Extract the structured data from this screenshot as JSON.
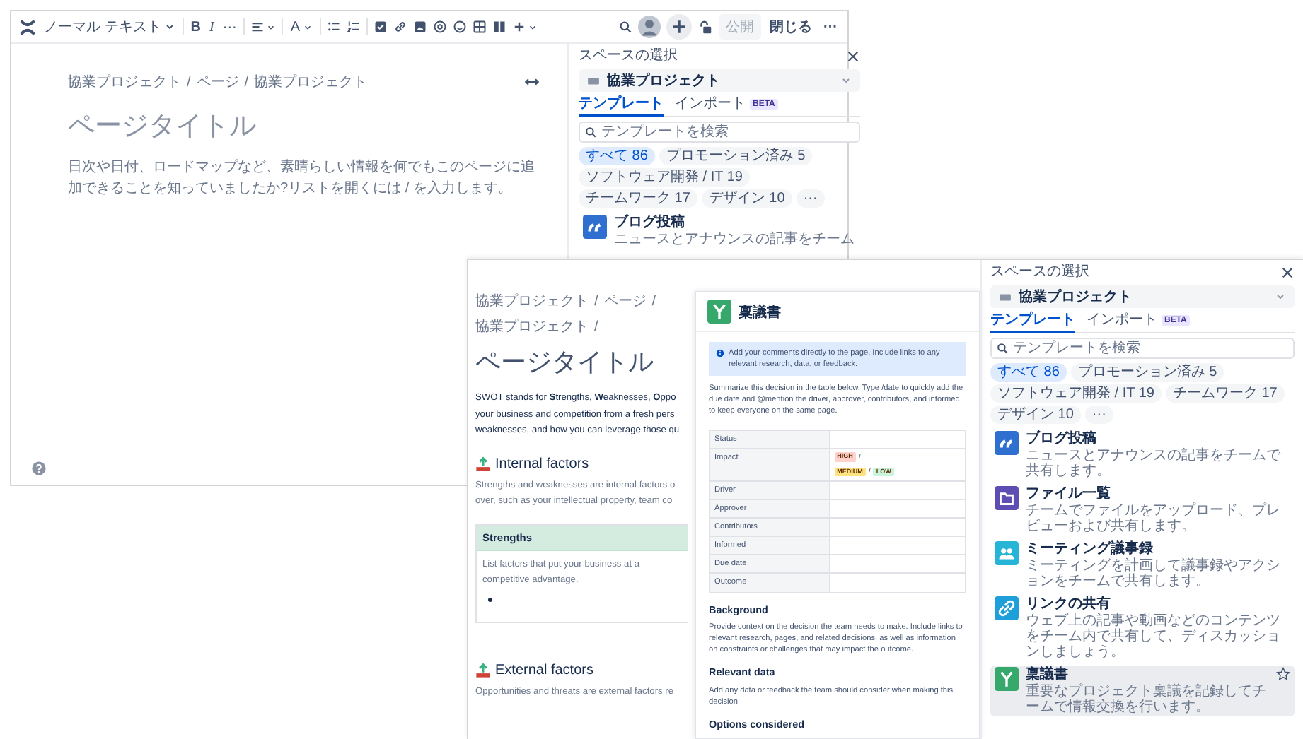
{
  "window_a": {
    "toolbar": {
      "style_menu": "ノーマル テキスト",
      "format_buttons": [
        {
          "kind": "bold",
          "label": "B"
        },
        {
          "kind": "italic",
          "label": "I"
        },
        {
          "kind": "more",
          "label": "···"
        }
      ],
      "text_color": "A",
      "publish": {
        "label": "公開",
        "disabled": true
      },
      "close": "閉じる",
      "more": "···"
    },
    "editor": {
      "breadcrumb": [
        "協業プロジェクト",
        "ページ",
        "協業プロジェクト"
      ],
      "separator": "/",
      "title": {
        "placeholder": "ページタイトル"
      },
      "body": {
        "placeholder": "日次や日付、ロードマップなど、素晴らしい情報を何でもこのページに追加できることを知っていましたか?リストを開くには / を入力します。"
      }
    },
    "panel": {
      "space_label": "スペースの選択",
      "space": "協業プロジェクト",
      "tabs": [
        {
          "label": "テンプレート",
          "selected": true
        },
        {
          "label": "インポート",
          "selected": false,
          "badge": "BETA"
        }
      ],
      "search": {
        "placeholder": "テンプレートを検索"
      },
      "filters": [
        {
          "label": "すべて 86",
          "selected": true
        },
        {
          "label": "プロモーション済み 5",
          "selected": false
        },
        {
          "label": "ソフトウェア開発 / IT 19",
          "selected": false
        },
        {
          "label": "チームワーク 17",
          "selected": false
        },
        {
          "label": "デザイン 10",
          "selected": false
        },
        {
          "label": "···",
          "selected": false
        }
      ],
      "templates": [
        {
          "kind": "quote",
          "color": "#2f6fcf",
          "title": "ブログ投稿",
          "description": "ニュースとアナウンスの記事をチーム",
          "selected": false
        }
      ]
    }
  },
  "window_b": {
    "page": {
      "breadcrumb": [
        "協業プロジェクト",
        "ページ",
        "協業プロジェクト"
      ],
      "separator": "/",
      "trailing_separator": true,
      "title": "ページタイトル",
      "blocks": [
        {
          "kind": "text",
          "lines": [
            "SWOT stands for **S**trengths, **W**eaknesses, **O**ppo",
            "your business and competition from a fresh pers",
            "weaknesses, and how you can leverage those qu"
          ]
        },
        {
          "kind": "heading",
          "text": "Internal factors"
        },
        {
          "kind": "text",
          "lines": [
            "Strengths and weaknesses are internal factors o",
            "over, such as your intellectual property, team co"
          ]
        },
        {
          "kind": "table",
          "header": "Strengths",
          "lines": [
            "List factors that put your business at a",
            "competitive advantage."
          ],
          "bullet": true
        },
        {
          "kind": "heading",
          "text": "External factors"
        },
        {
          "kind": "text",
          "lines": [
            "Opportunities and threats are external factors re"
          ]
        }
      ]
    },
    "dialog": {
      "title": "稟議書",
      "info": "Add your comments directly to the page. Include links to any relevant research, data, or feedback.",
      "summary": "Summarize this decision in the table below. Type /date to quickly add the due date and @mention the driver, approver, contributors, and informed to keep everyone on the same page.",
      "rows": [
        {
          "label": "Status"
        },
        {
          "label": "Impact",
          "lozenges": [
            {
              "text": "HIGH",
              "color": "#ffd2cc"
            },
            {
              "text": "MEDIUM",
              "color": "#ffe380"
            },
            {
              "text": "LOW",
              "color": "#c9f5dc"
            }
          ],
          "separator": "/"
        },
        {
          "label": "Driver"
        },
        {
          "label": "Approver"
        },
        {
          "label": "Contributors"
        },
        {
          "label": "Informed"
        },
        {
          "label": "Due date"
        },
        {
          "label": "Outcome"
        }
      ],
      "sections": [
        {
          "heading": "Background",
          "text": "Provide context on the decision the team needs to make. Include links to relevant research, pages, and related decisions, as well as information on constraints or challenges that may impact the outcome."
        },
        {
          "heading": "Relevant data",
          "text": "Add any data or feedback the team should consider when making this decision"
        },
        {
          "heading": "Options considered"
        }
      ]
    },
    "panel": {
      "space_label": "スペースの選択",
      "space": "協業プロジェクト",
      "tabs": [
        {
          "label": "テンプレート",
          "selected": true
        },
        {
          "label": "インポート",
          "selected": false,
          "badge": "BETA"
        }
      ],
      "search": {
        "placeholder": "テンプレートを検索"
      },
      "filters": [
        {
          "label": "すべて 86",
          "selected": true
        },
        {
          "label": "プロモーション済み 5",
          "selected": false
        },
        {
          "label": "ソフトウェア開発 / IT 19",
          "selected": false
        },
        {
          "label": "チームワーク 17",
          "selected": false
        },
        {
          "label": "デザイン 10",
          "selected": false
        },
        {
          "label": "···",
          "selected": false
        }
      ],
      "templates": [
        {
          "kind": "quote",
          "color": "#2f6fcf",
          "title": "ブログ投稿",
          "description": "ニュースとアナウンスの記事をチームで共有します。",
          "selected": false
        },
        {
          "kind": "folder",
          "color": "#5e4db2",
          "title": "ファイル一覧",
          "description": "チームでファイルをアップロード、プレビューおよび共有します。",
          "selected": false
        },
        {
          "kind": "people",
          "color": "#26b5d6",
          "title": "ミーティング議事録",
          "description": "ミーティングを計画して議事録やアクションをチームで共有します。",
          "selected": false
        },
        {
          "kind": "link",
          "color": "#1f9fd9",
          "title": "リンクの共有",
          "description": "ウェブ上の記事や動画などのコンテンツをチーム内で共有して、ディスカッションしましょう。",
          "selected": false
        },
        {
          "kind": "decision",
          "color": "#36a86b",
          "title": "稟議書",
          "description": "重要なプロジェクト稟議を記録してチームで情報交換を行います。",
          "selected": true
        }
      ]
    }
  }
}
